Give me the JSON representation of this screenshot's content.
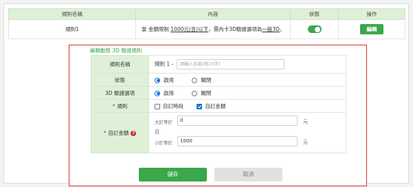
{
  "table": {
    "headers": [
      "規則名稱",
      "內容",
      "狀態",
      "操作"
    ],
    "rows": [
      {
        "name": "規則1",
        "content_prefix": "當 金額限制 ",
        "content_link1": "1000元(含)以下",
        "content_middle": "，需內卡3D驗證選項為",
        "content_link2": "一般3D",
        "content_suffix": "。",
        "status_on": true,
        "edit_label": "編輯"
      }
    ]
  },
  "edit_panel": {
    "title": "編輯動態 3D 驗證規則",
    "rule_name": {
      "label": "規則名稱",
      "prefix": "規則 1 -",
      "placeholder": "請輸入名稱(限20字)"
    },
    "status": {
      "label": "狀態",
      "options": [
        "啟用",
        "關閉"
      ],
      "selected": "啟用"
    },
    "verify_option": {
      "label": "3D 驗證選項",
      "options": [
        "啟用",
        "關閉"
      ],
      "selected": "啟用"
    },
    "rule": {
      "label": "規則",
      "required_mark": "*",
      "options": [
        {
          "label": "自訂時段",
          "checked": false
        },
        {
          "label": "自訂金額",
          "checked": true
        }
      ]
    },
    "custom_amount": {
      "label": "自訂金額",
      "required_mark": "*",
      "help_icon": "question-circle-icon",
      "greater_label": "大於等於",
      "greater_value": "0",
      "or_label": "且",
      "less_label": "小於等於",
      "less_value": "1000",
      "unit": "元"
    },
    "save_label": "儲存",
    "cancel_label": "取消"
  },
  "colors": {
    "brand_green": "#3aa84a",
    "header_bg": "#dff0d8",
    "highlight_red": "#d22f2f",
    "radio_blue": "#1a6fd6"
  }
}
